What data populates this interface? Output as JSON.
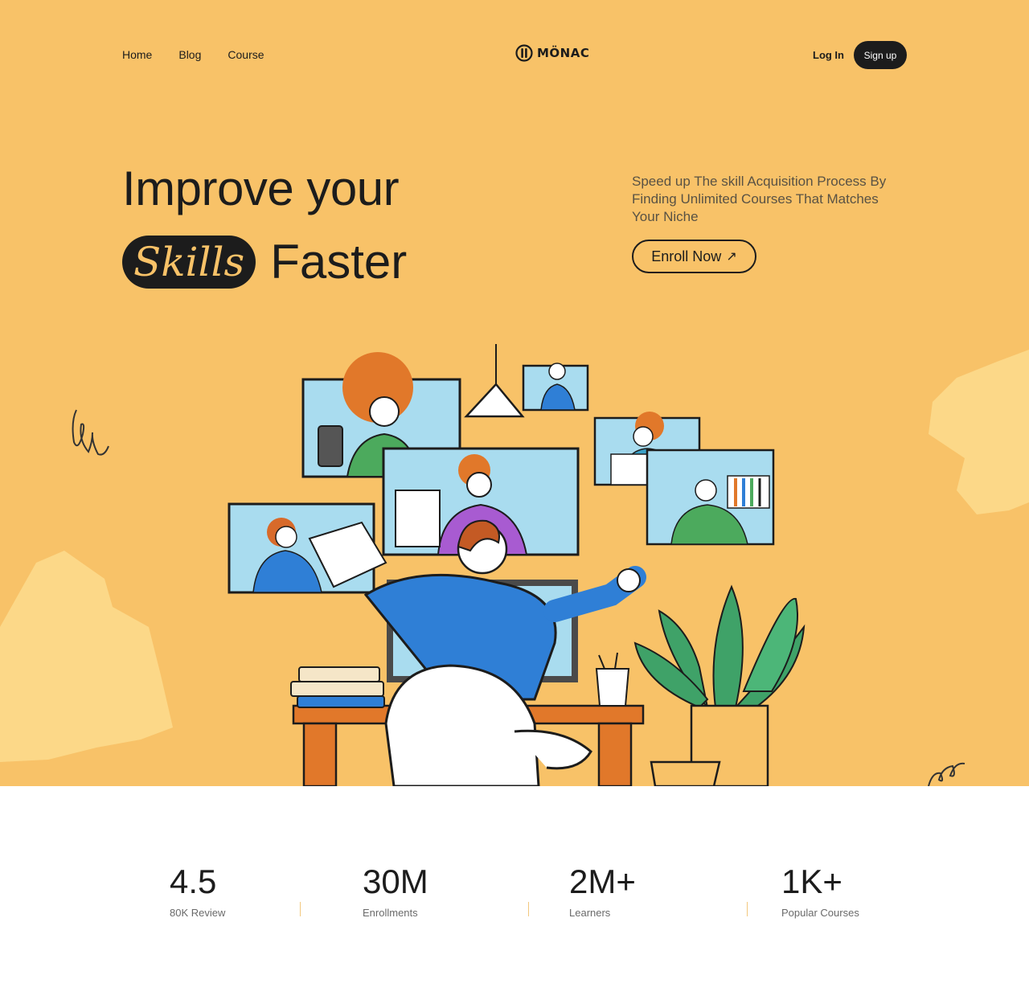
{
  "nav": {
    "links": [
      "Home",
      "Blog",
      "Course"
    ],
    "logo_text": "MÖNAC",
    "login_label": "Log In",
    "signup_label": "Sign up"
  },
  "hero": {
    "headline_line1": "Improve your",
    "highlight_word": "Skills",
    "headline_line2": "Faster",
    "subtitle": "Speed up The skill Acquisition Process By Finding Unlimited Courses That Matches Your Niche",
    "cta_label": "Enroll Now",
    "cta_arrow": "↗",
    "illustration_icon": "online-learning-illustration"
  },
  "stats": [
    {
      "value": "4.5",
      "label": "80K Review"
    },
    {
      "value": "30M",
      "label": "Enrollments"
    },
    {
      "value": "2M+",
      "label": "Learners"
    },
    {
      "value": "1K+",
      "label": "Popular Courses"
    }
  ],
  "colors": {
    "hero_bg": "#f8c268",
    "dark": "#1c1c1c",
    "accent_shape": "#fcd888",
    "divider": "#f2c87e"
  }
}
